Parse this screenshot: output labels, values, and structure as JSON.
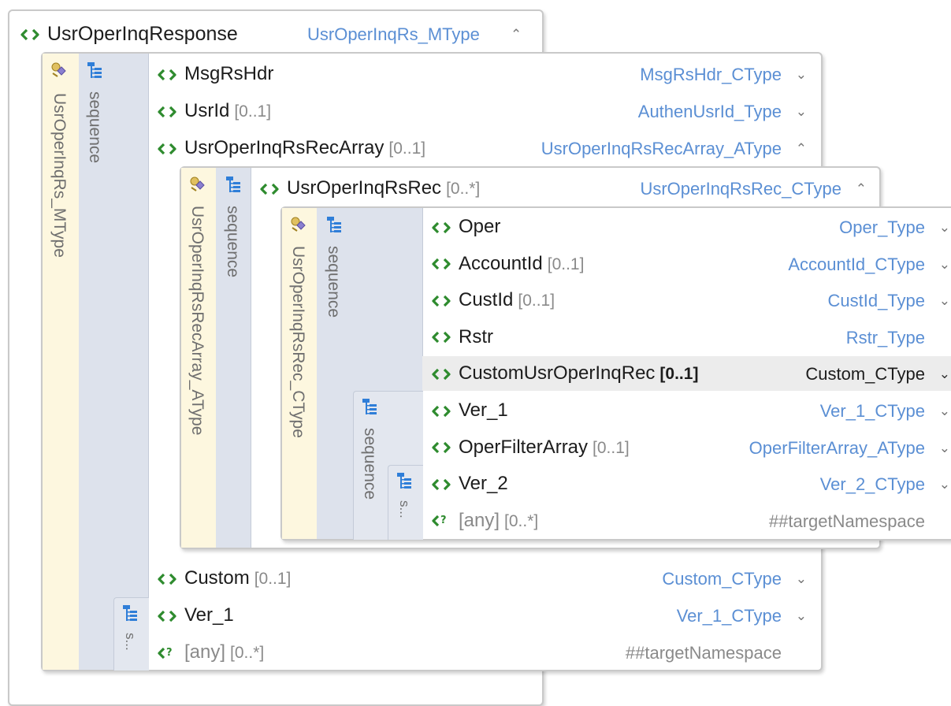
{
  "root": {
    "name": "UsrOperInqResponse",
    "type": "UsrOperInqRs_MType",
    "complex_type_label": "UsrOperInqRs_MType",
    "sequence_label": "sequence",
    "inner_sequence_label": "s...",
    "children": [
      {
        "name": "MsgRsHdr",
        "card": "",
        "type": "MsgRsHdr_CType",
        "expand": "expand-down"
      },
      {
        "name": "UsrId",
        "card": "[0..1]",
        "type": "AuthenUsrId_Type",
        "expand": "expand-down"
      },
      {
        "name": "UsrOperInqRsRecArray",
        "card": "[0..1]",
        "type": "UsrOperInqRsRecArray_AType",
        "expand": "collapse-up"
      }
    ],
    "after_children": [
      {
        "name": "Custom",
        "card": "[0..1]",
        "type": "Custom_CType",
        "expand": "expand-down"
      },
      {
        "name": "Ver_1",
        "card": "",
        "type": "Ver_1_CType",
        "expand": "expand-down"
      },
      {
        "name": "[any]",
        "card": "[0..*]",
        "type": "##targetNamespace",
        "expand": ""
      }
    ]
  },
  "array": {
    "complex_type_label": "UsrOperInqRsRecArray_AType",
    "sequence_label": "sequence",
    "rec": {
      "name": "UsrOperInqRsRec",
      "card": "[0..*]",
      "type": "UsrOperInqRsRec_CType",
      "expand": "collapse-up"
    }
  },
  "rec": {
    "complex_type_label": "UsrOperInqRsRec_CType",
    "sequence_label": "sequence",
    "sub_sequence_label": "sequence",
    "inner_sequence_label": "s...",
    "children": [
      {
        "name": "Oper",
        "card": "",
        "type": "Oper_Type",
        "expand": "expand-down"
      },
      {
        "name": "AccountId",
        "card": "[0..1]",
        "type": "AccountId_CType",
        "expand": "expand-down"
      },
      {
        "name": "CustId",
        "card": "[0..1]",
        "type": "CustId_Type",
        "expand": "expand-down"
      },
      {
        "name": "Rstr",
        "card": "",
        "type": "Rstr_Type",
        "expand": ""
      },
      {
        "name": "CustomUsrOperInqRec",
        "card": "[0..1]",
        "type": "Custom_CType",
        "expand": "expand-down",
        "highlighted": true
      },
      {
        "name": "Ver_1",
        "card": "",
        "type": "Ver_1_CType",
        "expand": "expand-down"
      },
      {
        "name": "OperFilterArray",
        "card": "[0..1]",
        "type": "OperFilterArray_AType",
        "expand": "expand-down"
      },
      {
        "name": "Ver_2",
        "card": "",
        "type": "Ver_2_CType",
        "expand": "expand-down"
      },
      {
        "name": "[any]",
        "card": "[0..*]",
        "type": "##targetNamespace",
        "expand": ""
      }
    ]
  },
  "colors": {
    "type_link": "#5b8fd4",
    "element_icon": "#2e8b2e",
    "sequence_bg": "#dde2ec",
    "complex_type_bg": "#fdf7df"
  }
}
